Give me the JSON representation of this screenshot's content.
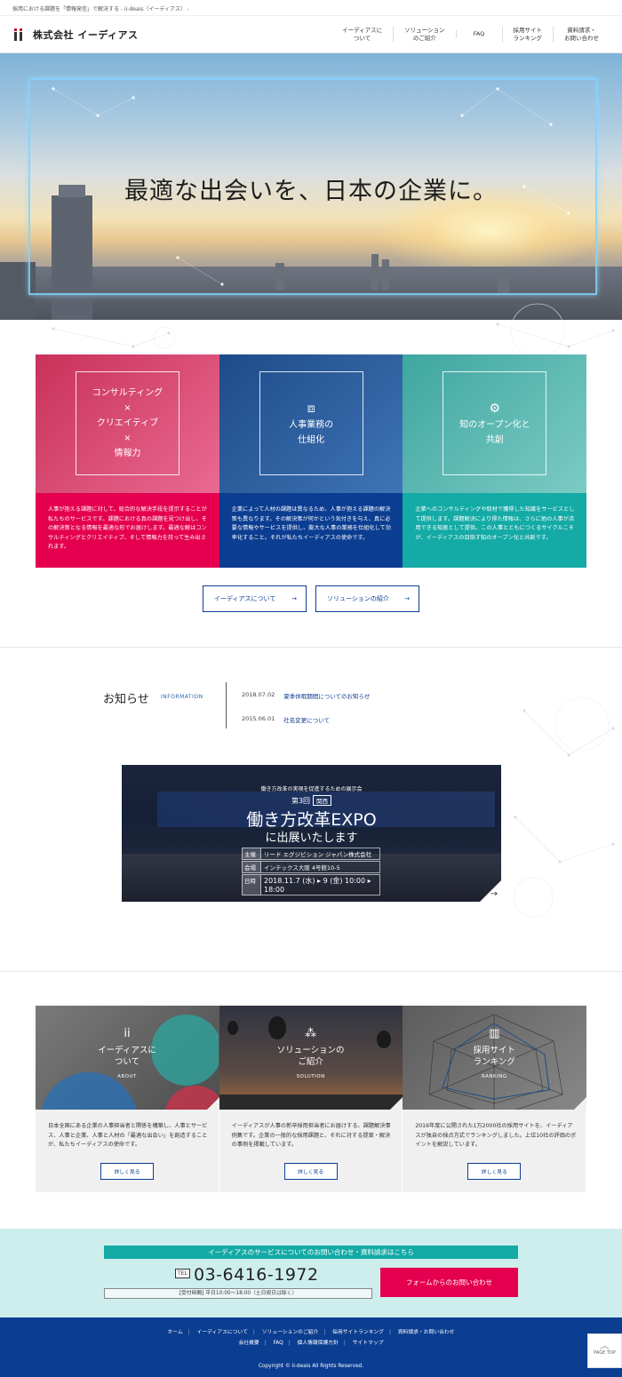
{
  "topbar": {
    "text": "採用における課題を「情報発信」で解決する - ii-deais（イーディアス） -"
  },
  "header": {
    "logo_text": "株式会社 イーディアス",
    "nav": [
      {
        "label": "イーディアスに\nついて"
      },
      {
        "label": "ソリューション\nのご紹介"
      },
      {
        "label": "FAQ"
      },
      {
        "label": "採用サイト\nランキング"
      },
      {
        "label": "資料請求・\nお問い合わせ"
      }
    ]
  },
  "hero": {
    "title": "最適な出会いを、日本の企業に。"
  },
  "cards": [
    {
      "lines": [
        "コンサルティング",
        "×",
        "クリエイティブ",
        "×",
        "情報力"
      ],
      "body": "人事が抱える課題に対して、総合的な解決手段を提示することが私たちのサービスです。課題における真の課題を見つけ出し、その解決策となる情報を最適な形でお届けします。最適な解はコンサルティングとクリエイティブ、そして情報力を持って生み出されます。"
    },
    {
      "lines": [
        "人事業務の",
        "仕組化"
      ],
      "body": "企業によって人材の課題は異なるため、人事が抱える課題の解決策も異なります。その解決策が何かという気付きを与え、真に必要な情報やサービスを提供し、膨大な人事の業務を仕組化して効率化すること。それが私たちイーディアスの使命です。"
    },
    {
      "lines": [
        "知のオープン化と",
        "共創"
      ],
      "body": "企業へのコンサルティングや取材で獲得した知識をサービスとして提供します。課題解決により得た情報は、さらに他の人事が活用できる知恵として提供。この人事とともにつくるサイクルこそが、イーディアスの目指す知のオープン化と共創です。"
    }
  ],
  "buttons": {
    "about": "イーディアスについて",
    "solution": "ソリューションの紹介",
    "arrow": "→"
  },
  "news": {
    "title": "お知らせ",
    "subtitle": "INFORMATION",
    "items": [
      {
        "date": "2018.07.02",
        "text": "夏季休暇期間についてのお知らせ"
      },
      {
        "date": "2015.06.01",
        "text": "社名変更について"
      }
    ]
  },
  "banner": {
    "kicker": "働き方改革の実現を促進するための展示会",
    "edition": "第3回",
    "tag": "関西",
    "title": "働き方改革EXPO",
    "title2": "に出展いたします",
    "rows": [
      {
        "k": "主催",
        "v": "リード エグジビション ジャパン株式会社"
      },
      {
        "k": "会場",
        "v": "インテックス大阪  4号館10-5"
      },
      {
        "k": "日時",
        "v": "2018.11.7 (水) ▸ 9 (金) 10:00 ▸ 18:00"
      }
    ]
  },
  "cards2": [
    {
      "label": [
        "イーディアスに",
        "ついて"
      ],
      "en": "ABOUT",
      "body": "日本全国にある企業の人事担当者と関係を構築し、人事とサービス、人事と企業、人事と人材の「最適な出会い」を創造することが、私たちイーディアスの使命です。",
      "button": "詳しく見る"
    },
    {
      "label": [
        "ソリューションの",
        "ご紹介"
      ],
      "en": "SOLUTION",
      "body": "イーディアスが人事の新卒採用担当者にお届けする、課題解決事例集です。企業の一般的な採用課題と、それに対する提案・解決の事例を掲載しています。",
      "button": "詳しく見る"
    },
    {
      "label": [
        "採用サイト",
        "ランキング"
      ],
      "en": "RANKING",
      "body": "2016年度に公開された1万2000社の採用サイトを、イーディアスが独自の採点方式でランキングしました。上位10社の評価のポイントを解説しています。",
      "button": "詳しく見る"
    }
  ],
  "contact": {
    "heading": "イーディアスのサービスについてのお問い合わせ・資料請求はこちら",
    "tel_label": "TEL",
    "tel": "03-6416-1972",
    "hours": "[受付時間] 平日10:00〜18:00（土日祝日は除く）",
    "form_button": "フォームからのお問い合わせ"
  },
  "footer": {
    "links_row1": [
      "ホーム",
      "イーディアスについて",
      "ソリューションのご紹介",
      "採用サイトランキング",
      "資料請求・お問い合わせ"
    ],
    "links_row2": [
      "会社概要",
      "FAQ",
      "個人情報保護方針",
      "サイトマップ"
    ],
    "copyright": "Copyright © ii-deais All Rights Reserved."
  },
  "pagetop": "PAGE TOP",
  "colors": {
    "pink": "#e5004f",
    "navy": "#0b3d91",
    "teal": "#14aaa6",
    "contact_bg": "#cdeeed"
  }
}
